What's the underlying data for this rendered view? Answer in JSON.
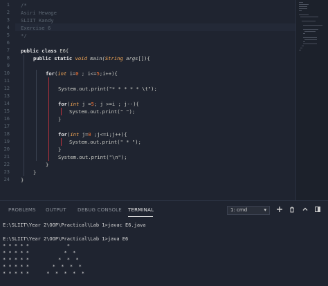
{
  "editor": {
    "line_numbers": [
      "1",
      "2",
      "3",
      "4",
      "5",
      "6",
      "7",
      "8",
      "9",
      "10",
      "11",
      "12",
      "13",
      "14",
      "15",
      "16",
      "17",
      "18",
      "19",
      "20",
      "21",
      "22",
      "23",
      "24"
    ],
    "comment": {
      "l1": "/*",
      "l2": "Asiri Hewage",
      "l3": "SLIIT Kandy",
      "l4": "Exercise 6",
      "l5": "*/"
    },
    "code": {
      "l7_kw": "public class",
      "l7_rest": " E6{",
      "l8_kw": "public static",
      "l8_type": " void",
      "l8_it1": " main(",
      "l8_type2": "String",
      "l8_it2": " args",
      "l8_rest": "[]){",
      "l10_kw": "for",
      "l10_a": "(",
      "l10_type": "int",
      "l10_b": " i=",
      "l10_n1": "0",
      "l10_c": " ; i<=",
      "l10_n2": "5",
      "l10_d": ";i++){",
      "l12": "System.out.print(\"* * * * * \\t\");",
      "l14_kw": "for",
      "l14_a": "(",
      "l14_type": "int",
      "l14_b": " j =",
      "l14_n1": "5",
      "l14_c": "; j >=i ; j--){",
      "l15": "System.out.print(\" \");",
      "l16": "}",
      "l18_kw": "for",
      "l18_a": "(",
      "l18_type": "int",
      "l18_b": " j=",
      "l18_n1": "0",
      "l18_c": " ;j<=i;j++){",
      "l19": "System.out.print(\" * \");",
      "l20": "}",
      "l21": "System.out.print(\"\\n\");",
      "l22": "}",
      "l23": "}",
      "l24": "}"
    }
  },
  "panel": {
    "tabs": {
      "problems": "PROBLEMS",
      "output": "OUTPUT",
      "debug_console": "DEBUG CONSOLE",
      "terminal": "TERMINAL"
    },
    "terminal_select": "1: cmd",
    "terminal_lines": [
      "E:\\SLIIT\\Year 2\\OOP\\Practical\\Lab 1>javac E6.java",
      "",
      "E:\\SLIIT\\Year 2\\OOP\\Practical\\Lab 1>java E6",
      "* * * * *             *",
      "* * * * *            *  *",
      "* * * * *          *  *  *",
      "* * * * *        *  *  *  *",
      "* * * * *      *  *  *  *  *"
    ]
  },
  "icons": {
    "caret": "chevron-down-icon",
    "add": "plus-icon",
    "trash": "trash-icon",
    "up": "chevron-up-icon",
    "maximize": "maximize-icon"
  }
}
